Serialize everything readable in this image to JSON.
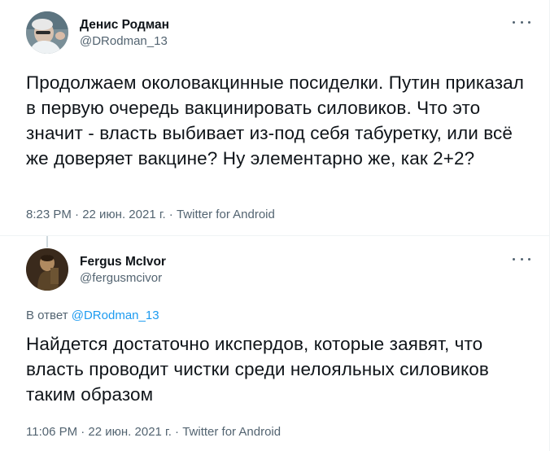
{
  "tweets": [
    {
      "author": {
        "display_name": "Денис Родман",
        "handle": "@DRodman_13",
        "avatar_icon": "avatar-photo"
      },
      "text": "Продолжаем околовакцинные посиделки. Путин приказал в первую очередь вакцинировать силовиков. Что это значит - власть выбивает из-под себя табуретку, или всё же доверяет вакцине? Ну элементарно же, как 2+2?",
      "meta": "8:23 PM · 22 июн. 2021 г. · Twitter for Android"
    },
    {
      "author": {
        "display_name": "Fergus McIvor",
        "handle": "@fergusmcivor",
        "avatar_icon": "avatar-photo"
      },
      "reply_to": {
        "prefix": "В ответ",
        "handle": "@DRodman_13"
      },
      "text": "Найдется достаточно икспердов, которые заявят, что власть проводит чистки среди нелояльных силовиков таким образом",
      "meta": "11:06 PM · 22 июн. 2021 г. · Twitter for Android"
    }
  ],
  "colors": {
    "text": "#0f1419",
    "secondary": "#536471",
    "link": "#1d9bf0",
    "divider": "#eff3f4"
  }
}
